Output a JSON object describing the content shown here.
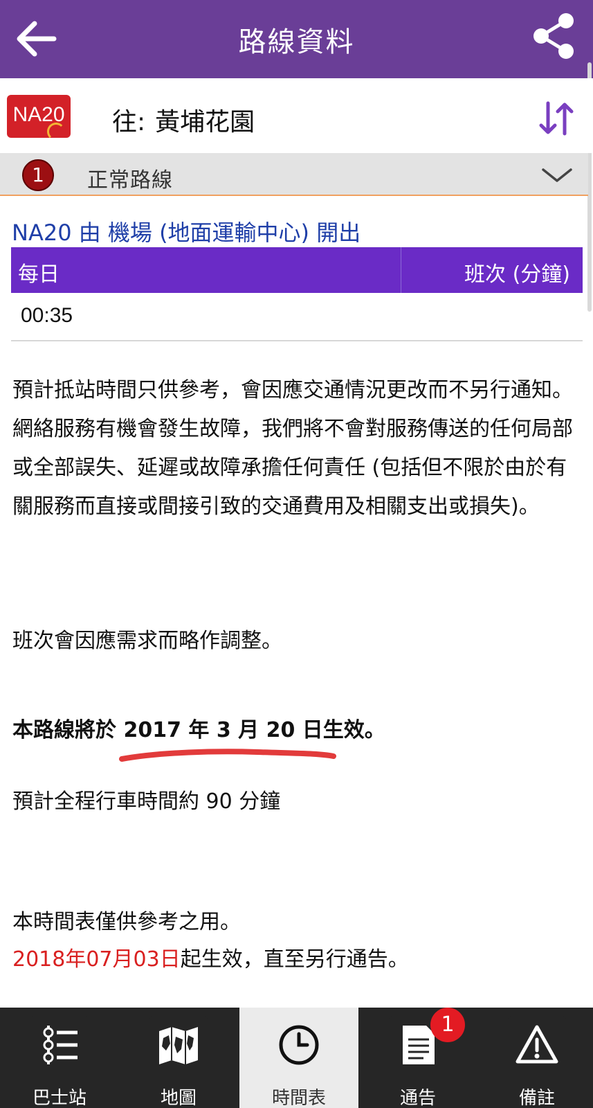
{
  "appbar": {
    "title": "路線資料",
    "back_icon": "arrow-left-icon",
    "share_icon": "share-icon",
    "background": "#6a3e97"
  },
  "route": {
    "code": "NA20",
    "direction_label": "往:",
    "destination": "黃埔花園",
    "badge_color": "#d32128",
    "swap_icon": "swap-direction-icon"
  },
  "variant": {
    "number": "1",
    "name": "正常路線"
  },
  "timetable": {
    "departure": "NA20 由 機場 (地面運輸中心) 開出",
    "header_day": "每日",
    "header_frequency": "班次 (分鐘)",
    "rows": [
      "00:35"
    ],
    "header_color": "#6a2bc6"
  },
  "notes": {
    "disclaimer": "預計抵站時間只供參考，會因應交通情況更改而不另行通知。網絡服務有機會發生故障，我們將不會對服務傳送的任何局部或全部誤失、延遲或故障承擔任何責任 (包括但不限於由於有關服務而直接或間接引致的交通費用及相關支出或損失)。",
    "frequency_note": "班次會因應需求而略作調整。",
    "effective_note": "本路線將於 2017 年 3 月 20 日生效。",
    "journey_time": "預計全程行車時間約 90 分鐘",
    "reference_note": "本時間表僅供參考之用。",
    "effective_date": "2018年07月03日",
    "effective_suffix": "起生效，直至另行通告。",
    "highlight_color": "#d92020"
  },
  "bottom_nav": {
    "tabs": [
      {
        "label": "巴士站",
        "icon": "bus-stops-list-icon",
        "active": false
      },
      {
        "label": "地圖",
        "icon": "map-icon",
        "active": false
      },
      {
        "label": "時間表",
        "icon": "clock-icon",
        "active": true
      },
      {
        "label": "通告",
        "icon": "notice-document-icon",
        "active": false,
        "badge": "1"
      },
      {
        "label": "備註",
        "icon": "warning-icon",
        "active": false
      }
    ]
  }
}
